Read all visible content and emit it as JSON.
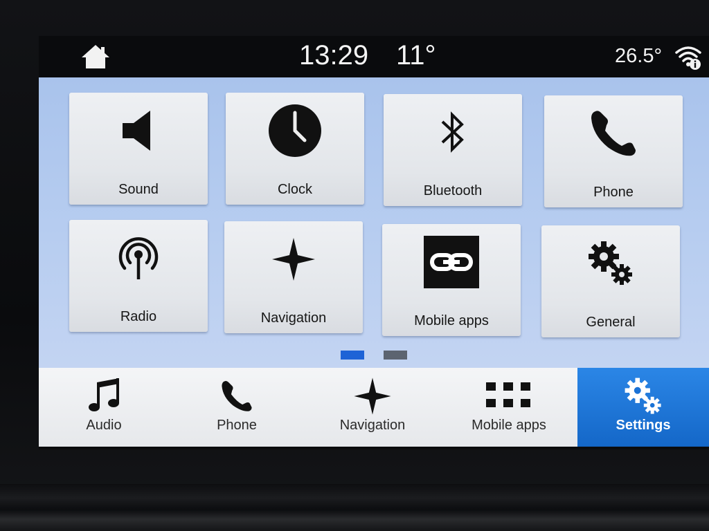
{
  "status": {
    "time": "13:29",
    "outside_temp": "11°",
    "cabin_temp": "26.5°",
    "home_icon": "home-icon",
    "wifi_icon": "wifi-info-icon"
  },
  "tiles": [
    {
      "label": "Sound",
      "icon": "speaker-icon"
    },
    {
      "label": "Clock",
      "icon": "clock-icon"
    },
    {
      "label": "Bluetooth",
      "icon": "bluetooth-icon"
    },
    {
      "label": "Phone",
      "icon": "phone-icon"
    },
    {
      "label": "Radio",
      "icon": "radio-antenna-icon"
    },
    {
      "label": "Navigation",
      "icon": "navigation-star-icon"
    },
    {
      "label": "Mobile apps",
      "icon": "mobile-apps-link-icon"
    },
    {
      "label": "General",
      "icon": "gears-icon"
    }
  ],
  "pagination": {
    "pages": 2,
    "current": 1
  },
  "bottom_nav": [
    {
      "label": "Audio",
      "icon": "music-note-icon",
      "active": false
    },
    {
      "label": "Phone",
      "icon": "phone-icon",
      "active": false
    },
    {
      "label": "Navigation",
      "icon": "navigation-star-icon",
      "active": false
    },
    {
      "label": "Mobile apps",
      "icon": "grid-icon",
      "active": false
    },
    {
      "label": "Settings",
      "icon": "gears-icon",
      "active": true
    }
  ],
  "colors": {
    "accent": "#1a72d6",
    "panel": "#b7cdf0",
    "dot_active": "#1e63d6",
    "dot_inactive": "#5c6470"
  }
}
